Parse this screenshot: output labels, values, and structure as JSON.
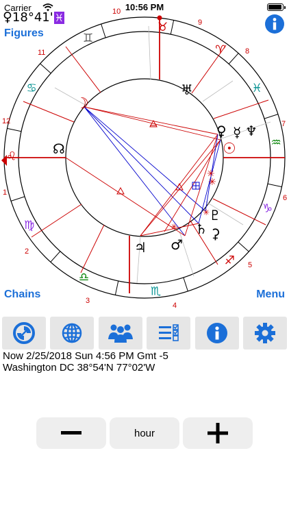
{
  "status_bar": {
    "carrier": "Carrier",
    "time": "10:56 PM",
    "battery_percent": 100
  },
  "header": {
    "planet_glyph": "♀",
    "position_text": "18°41'",
    "sign_glyph": "♓"
  },
  "links": {
    "figures": "Figures",
    "chains": "Chains",
    "menu": "Menu"
  },
  "toolbar": {
    "buttons": [
      {
        "name": "compass-icon"
      },
      {
        "name": "globe-icon"
      },
      {
        "name": "people-icon"
      },
      {
        "name": "checklist-icon"
      },
      {
        "name": "info-icon"
      },
      {
        "name": "gear-icon"
      }
    ]
  },
  "info": {
    "datetime": "Now 2/25/2018 Sun 4:56 PM Gmt -5",
    "location": "Washington DC 38°54'N 77°02'W"
  },
  "controls": {
    "minus": "−",
    "unit": "hour",
    "plus": "+"
  },
  "colors": {
    "accent": "#1b6fd8",
    "sign_red": "#cc0000",
    "sign_green": "#008000",
    "sign_purple": "#8a2be2",
    "sign_teal": "#009090"
  },
  "chart": {
    "house_numbers": [
      "1",
      "2",
      "3",
      "4",
      "5",
      "6",
      "7",
      "8",
      "9",
      "10",
      "11",
      "12"
    ],
    "signs": [
      {
        "glyph": "♈",
        "color": "#cc0000",
        "angle": 35
      },
      {
        "glyph": "♉",
        "color": "#cc0000",
        "angle": 8
      },
      {
        "glyph": "♊",
        "color": "#555555",
        "angle": -25
      },
      {
        "glyph": "♋",
        "color": "#009090",
        "angle": -58
      },
      {
        "glyph": "♌",
        "color": "#cc0000",
        "angle": -89
      },
      {
        "glyph": "♍",
        "color": "#8a2be2",
        "angle": -120
      },
      {
        "glyph": "♎",
        "color": "#008000",
        "angle": -153
      },
      {
        "glyph": "♏",
        "color": "#009090",
        "angle": 175
      },
      {
        "glyph": "♐",
        "color": "#cc0000",
        "angle": 140
      },
      {
        "glyph": "♑",
        "color": "#8a2be2",
        "angle": 112
      },
      {
        "glyph": "♒",
        "color": "#008000",
        "angle": 83
      },
      {
        "glyph": "♓",
        "color": "#009090",
        "angle": 58
      }
    ],
    "planets": [
      {
        "glyph": "☽",
        "color": "#cc0000"
      },
      {
        "glyph": "☊",
        "color": "#000000"
      },
      {
        "glyph": "♅",
        "color": "#000000"
      },
      {
        "glyph": "♀",
        "color": "#000000"
      },
      {
        "glyph": "☿",
        "color": "#000000"
      },
      {
        "glyph": "♆",
        "color": "#000000"
      },
      {
        "glyph": "☉",
        "color": "#cc0000"
      },
      {
        "glyph": "♇",
        "color": "#000000"
      },
      {
        "glyph": "♄",
        "color": "#000000"
      },
      {
        "glyph": "⚳",
        "color": "#000000"
      },
      {
        "glyph": "♃",
        "color": "#000000"
      },
      {
        "glyph": "♂",
        "color": "#000000"
      }
    ]
  }
}
